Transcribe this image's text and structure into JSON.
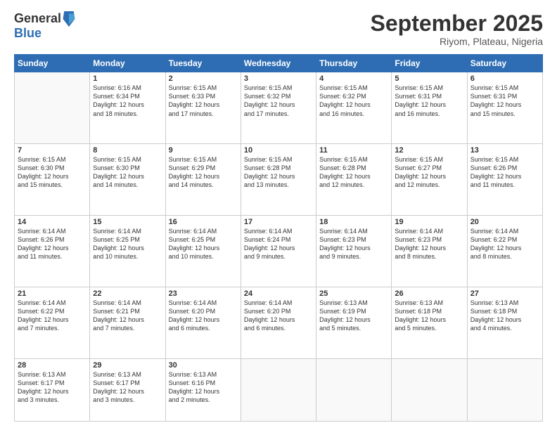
{
  "logo": {
    "general": "General",
    "blue": "Blue"
  },
  "header": {
    "month": "September 2025",
    "location": "Riyom, Plateau, Nigeria"
  },
  "weekdays": [
    "Sunday",
    "Monday",
    "Tuesday",
    "Wednesday",
    "Thursday",
    "Friday",
    "Saturday"
  ],
  "weeks": [
    [
      {
        "day": "",
        "info": ""
      },
      {
        "day": "1",
        "info": "Sunrise: 6:16 AM\nSunset: 6:34 PM\nDaylight: 12 hours\nand 18 minutes."
      },
      {
        "day": "2",
        "info": "Sunrise: 6:15 AM\nSunset: 6:33 PM\nDaylight: 12 hours\nand 17 minutes."
      },
      {
        "day": "3",
        "info": "Sunrise: 6:15 AM\nSunset: 6:32 PM\nDaylight: 12 hours\nand 17 minutes."
      },
      {
        "day": "4",
        "info": "Sunrise: 6:15 AM\nSunset: 6:32 PM\nDaylight: 12 hours\nand 16 minutes."
      },
      {
        "day": "5",
        "info": "Sunrise: 6:15 AM\nSunset: 6:31 PM\nDaylight: 12 hours\nand 16 minutes."
      },
      {
        "day": "6",
        "info": "Sunrise: 6:15 AM\nSunset: 6:31 PM\nDaylight: 12 hours\nand 15 minutes."
      }
    ],
    [
      {
        "day": "7",
        "info": ""
      },
      {
        "day": "8",
        "info": "Sunrise: 6:15 AM\nSunset: 6:30 PM\nDaylight: 12 hours\nand 14 minutes."
      },
      {
        "day": "9",
        "info": "Sunrise: 6:15 AM\nSunset: 6:29 PM\nDaylight: 12 hours\nand 14 minutes."
      },
      {
        "day": "10",
        "info": "Sunrise: 6:15 AM\nSunset: 6:28 PM\nDaylight: 12 hours\nand 13 minutes."
      },
      {
        "day": "11",
        "info": "Sunrise: 6:15 AM\nSunset: 6:28 PM\nDaylight: 12 hours\nand 12 minutes."
      },
      {
        "day": "12",
        "info": "Sunrise: 6:15 AM\nSunset: 6:27 PM\nDaylight: 12 hours\nand 12 minutes."
      },
      {
        "day": "13",
        "info": "Sunrise: 6:15 AM\nSunset: 6:26 PM\nDaylight: 12 hours\nand 11 minutes."
      }
    ],
    [
      {
        "day": "14",
        "info": ""
      },
      {
        "day": "15",
        "info": "Sunrise: 6:14 AM\nSunset: 6:25 PM\nDaylight: 12 hours\nand 10 minutes."
      },
      {
        "day": "16",
        "info": "Sunrise: 6:14 AM\nSunset: 6:25 PM\nDaylight: 12 hours\nand 10 minutes."
      },
      {
        "day": "17",
        "info": "Sunrise: 6:14 AM\nSunset: 6:24 PM\nDaylight: 12 hours\nand 9 minutes."
      },
      {
        "day": "18",
        "info": "Sunrise: 6:14 AM\nSunset: 6:23 PM\nDaylight: 12 hours\nand 9 minutes."
      },
      {
        "day": "19",
        "info": "Sunrise: 6:14 AM\nSunset: 6:23 PM\nDaylight: 12 hours\nand 8 minutes."
      },
      {
        "day": "20",
        "info": "Sunrise: 6:14 AM\nSunset: 6:22 PM\nDaylight: 12 hours\nand 8 minutes."
      }
    ],
    [
      {
        "day": "21",
        "info": ""
      },
      {
        "day": "22",
        "info": "Sunrise: 6:14 AM\nSunset: 6:21 PM\nDaylight: 12 hours\nand 7 minutes."
      },
      {
        "day": "23",
        "info": "Sunrise: 6:14 AM\nSunset: 6:20 PM\nDaylight: 12 hours\nand 6 minutes."
      },
      {
        "day": "24",
        "info": "Sunrise: 6:14 AM\nSunset: 6:20 PM\nDaylight: 12 hours\nand 6 minutes."
      },
      {
        "day": "25",
        "info": "Sunrise: 6:13 AM\nSunset: 6:19 PM\nDaylight: 12 hours\nand 5 minutes."
      },
      {
        "day": "26",
        "info": "Sunrise: 6:13 AM\nSunset: 6:18 PM\nDaylight: 12 hours\nand 5 minutes."
      },
      {
        "day": "27",
        "info": "Sunrise: 6:13 AM\nSunset: 6:18 PM\nDaylight: 12 hours\nand 4 minutes."
      }
    ],
    [
      {
        "day": "28",
        "info": ""
      },
      {
        "day": "29",
        "info": "Sunrise: 6:13 AM\nSunset: 6:17 PM\nDaylight: 12 hours\nand 3 minutes."
      },
      {
        "day": "30",
        "info": "Sunrise: 6:13 AM\nSunset: 6:16 PM\nDaylight: 12 hours\nand 2 minutes."
      },
      {
        "day": "",
        "info": ""
      },
      {
        "day": "",
        "info": ""
      },
      {
        "day": "",
        "info": ""
      },
      {
        "day": "",
        "info": ""
      }
    ]
  ],
  "week1_day7_info": "Sunrise: 6:15 AM\nSunset: 6:30 PM\nDaylight: 12 hours\nand 15 minutes.",
  "week2_day14_info": "Sunrise: 6:14 AM\nSunset: 6:26 PM\nDaylight: 12 hours\nand 11 minutes.",
  "week3_day21_info": "Sunrise: 6:14 AM\nSunset: 6:22 PM\nDaylight: 12 hours\nand 7 minutes.",
  "week4_day28_info": "Sunrise: 6:13 AM\nSunset: 6:17 PM\nDaylight: 12 hours\nand 3 minutes."
}
